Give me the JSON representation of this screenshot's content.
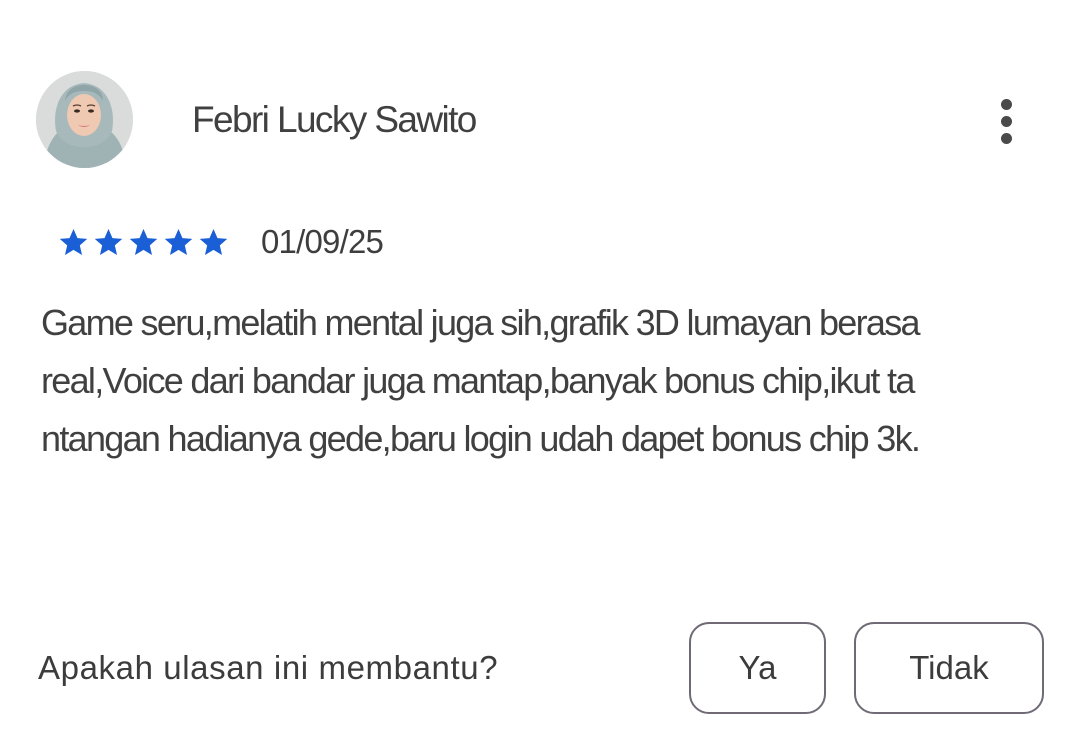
{
  "review": {
    "author": "Febri Lucky Sawito",
    "avatar_icon": "user-avatar-photo",
    "more_icon": "more-vertical-icon",
    "rating": 5,
    "rating_max": 5,
    "star_color": "#1a5fd6",
    "date": "01/09/25",
    "body_lines": [
      "Game seru,melatih mental juga sih,grafik 3D lumayan berasa",
      "real,Voice dari bandar juga mantap,banyak bonus chip,ikut ta",
      "ntangan hadianya gede,baru login udah dapet bonus chip 3k."
    ]
  },
  "helpful": {
    "question": "Apakah ulasan ini membantu?",
    "yes_label": "Ya",
    "no_label": "Tidak"
  }
}
